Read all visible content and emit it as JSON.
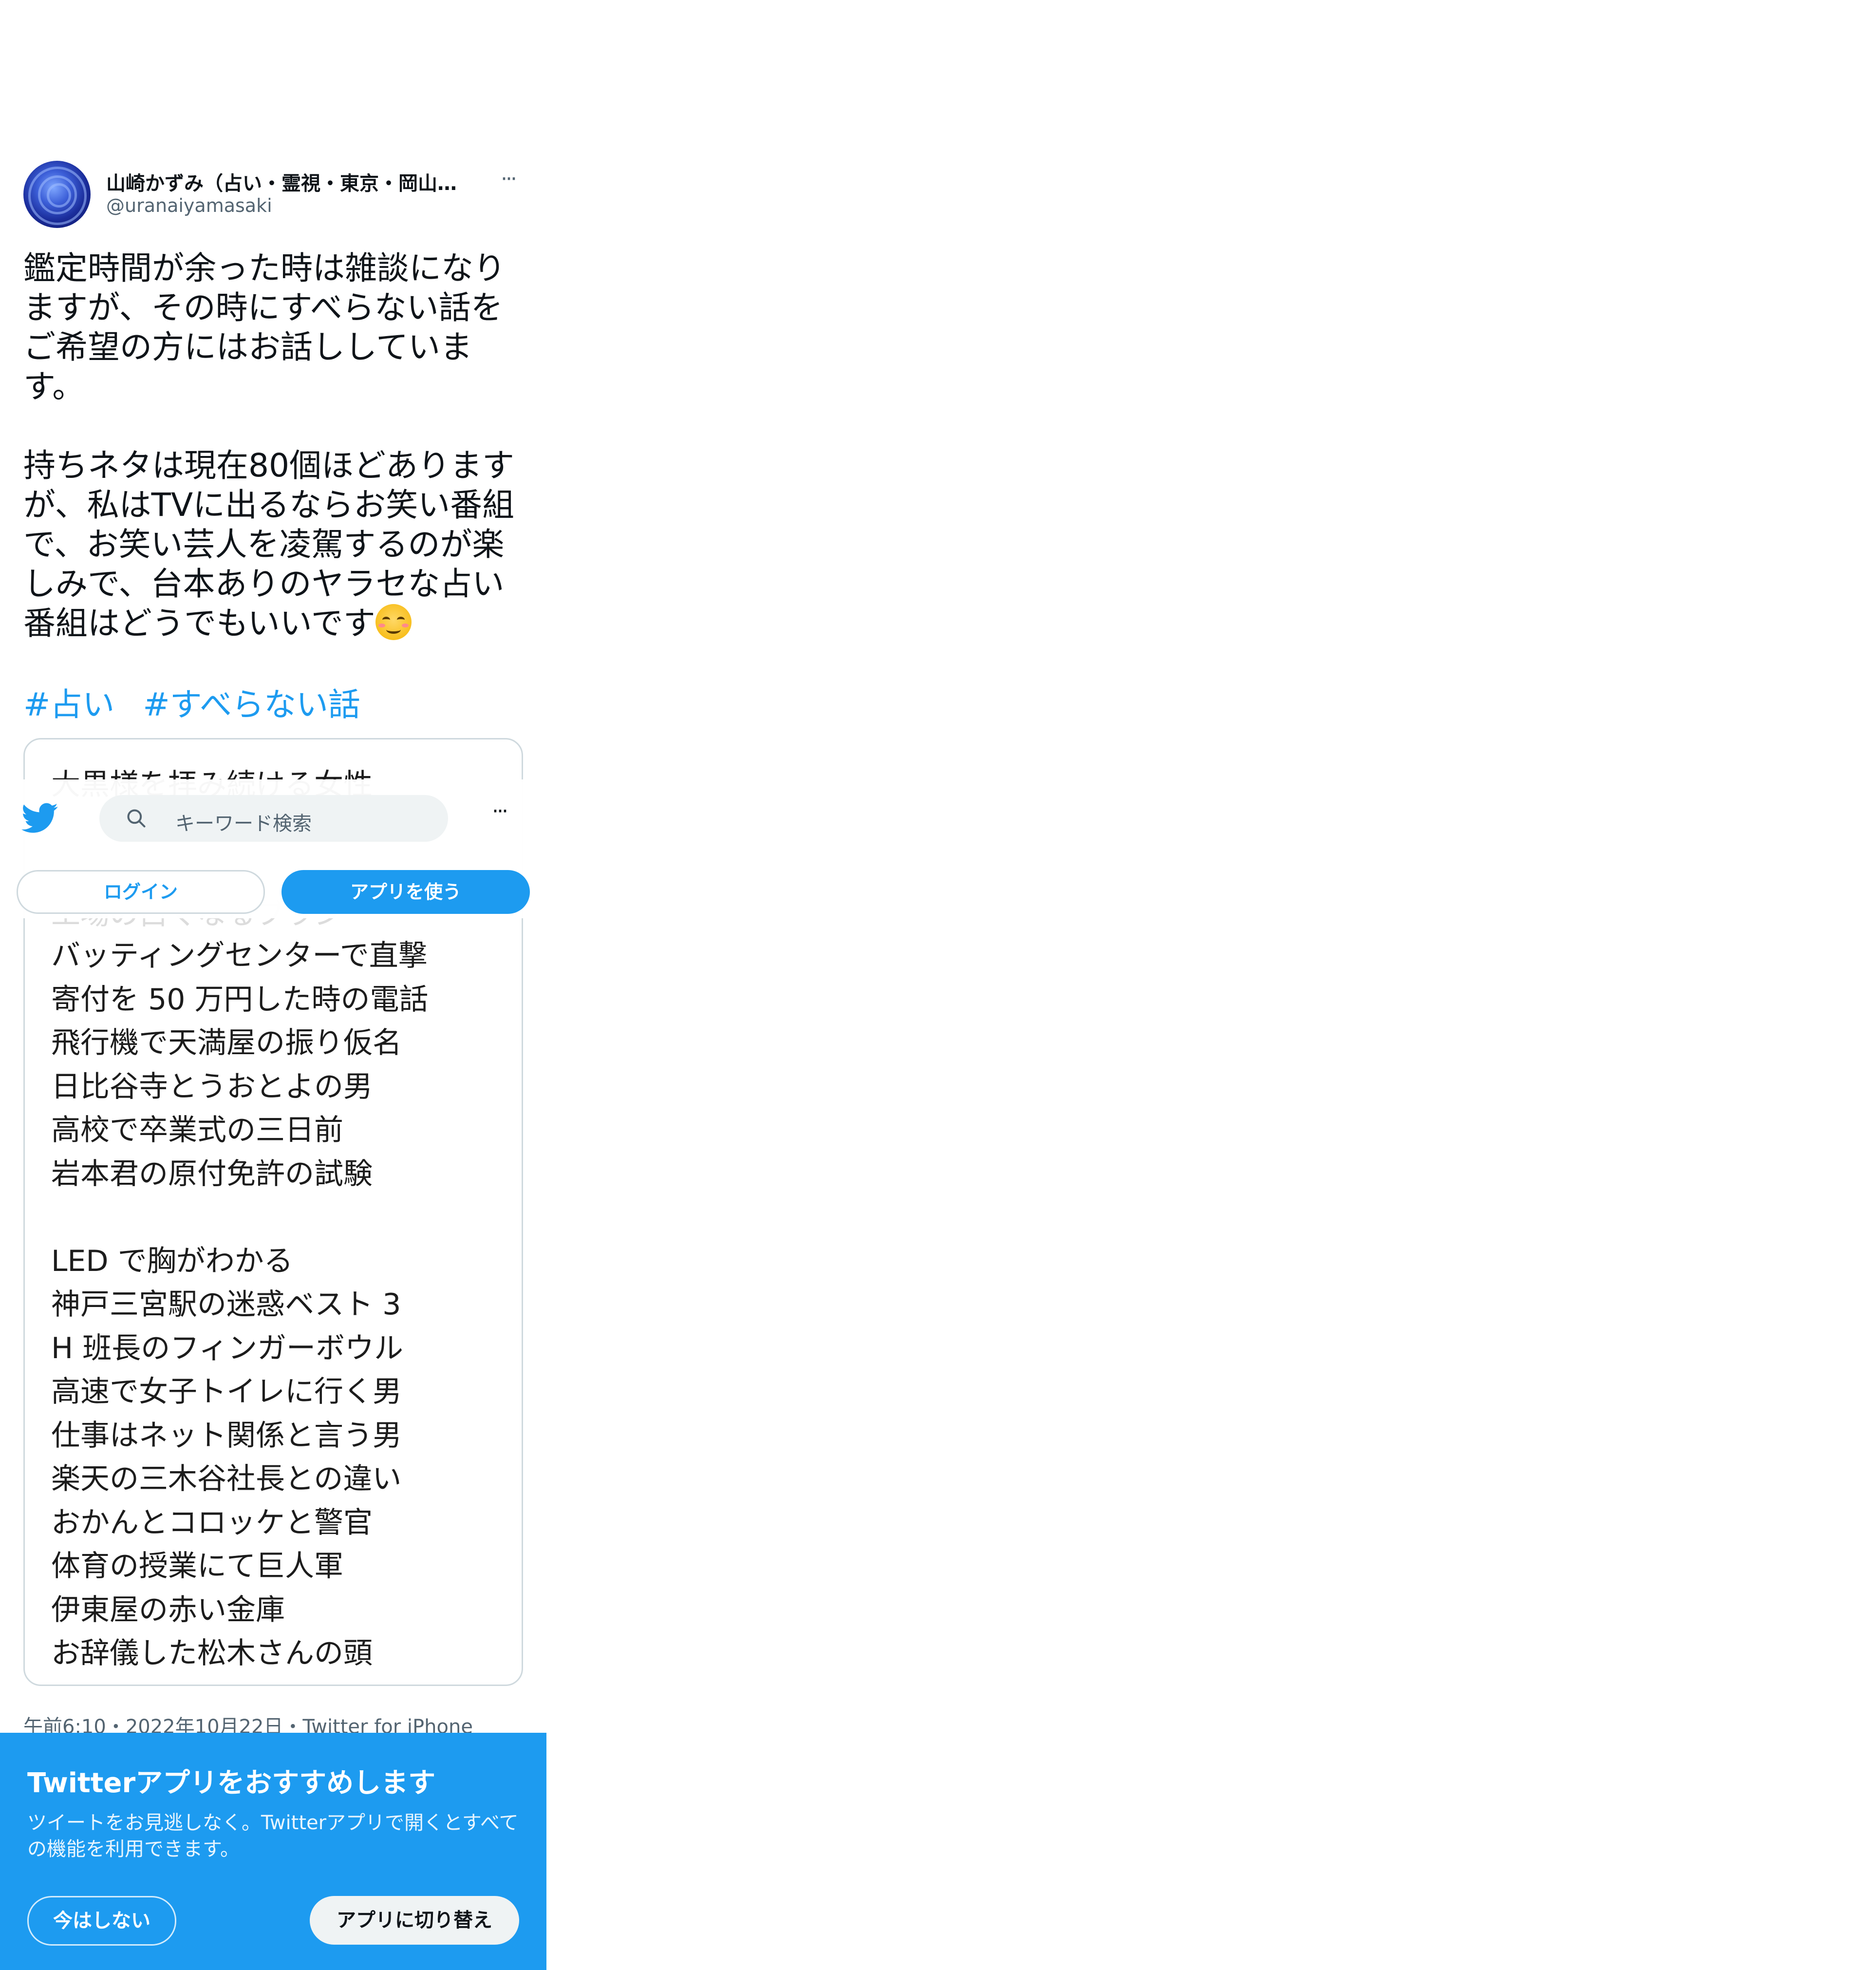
{
  "tweet": {
    "author_name": "山崎かずみ（占い・霊視・東京・岡山…",
    "author_handle": "@uranaiyamasaki",
    "more_label": "···",
    "text_part1": "鑑定時間が余った時は雑談になりますが、その時にすべらない話をご希望の方にはお話ししています。\n\n持ちネタは現在80個ほどありますが、私はTVに出るならお笑い番組で、お笑い芸人を凌駕するのが楽しみで、台本ありのヤラセな占い番組はどうでもいいです",
    "emoji": "smiling-face-with-smiling-eyes",
    "hashtags": [
      "#占い",
      "#すべらない話"
    ],
    "timestamp": "午前6:10・2022年10月22日・Twitter for iPhone"
  },
  "media": {
    "top_line": "大黒様を拝み続ける女性",
    "faded_line": "工場の白くなるブラシ",
    "list_text": "バッティングセンターで直撃\n寄付を 50 万円した時の電話\n飛行機で天満屋の振り仮名\n日比谷寺とうおとよの男\n高校で卒業式の三日前\n岩本君の原付免許の試験\n\nLED で胸がわかる\n神戸三宮駅の迷惑ベスト 3\nH 班長のフィンガーボウル\n高速で女子トイレに行く男\n仕事はネット関係と言う男\n楽天の三木谷社長との違い\nおかんとコロッケと警官\n体育の授業にて巨人軍\n伊東屋の赤い金庫\nお辞儀した松木さんの頭"
  },
  "topbar": {
    "search_placeholder": "キーワード検索",
    "more_label": "···",
    "login_label": "ログイン",
    "use_app_label": "アプリを使う"
  },
  "banner": {
    "title": "Twitterアプリをおすすめします",
    "description": "ツイートをお見逃しなく。Twitterアプリで開くとすべての機能を利用できます。",
    "not_now_label": "今はしない",
    "switch_label": "アプリに切り替え"
  },
  "colors": {
    "accent": "#1d9bf0",
    "secondary_text": "#536471",
    "border": "#cfd9de"
  }
}
